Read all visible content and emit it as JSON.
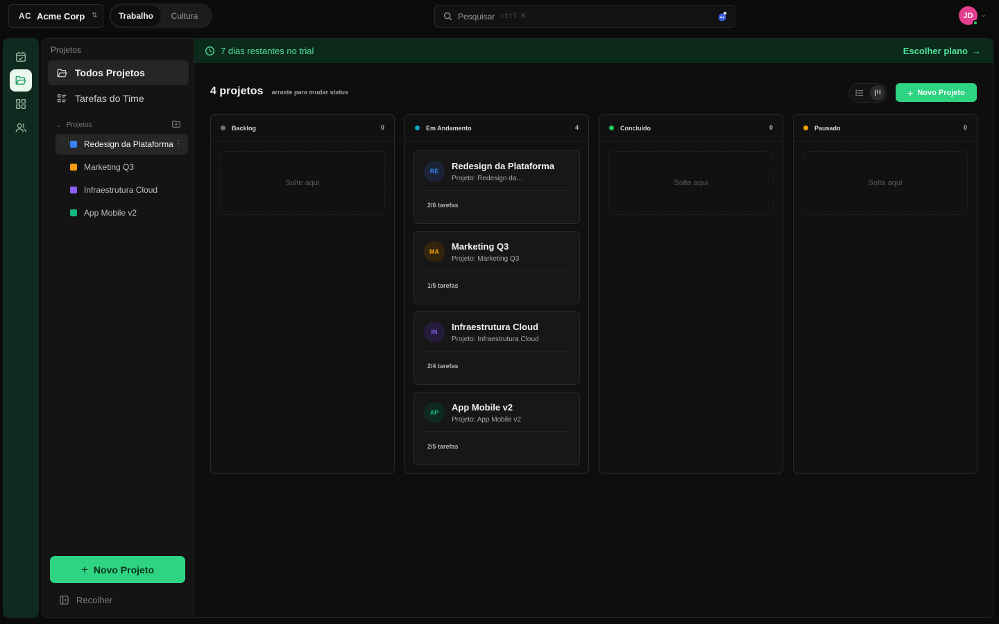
{
  "org": {
    "abbr": "AC",
    "name": "Acme Corp"
  },
  "workspace_tabs": [
    {
      "label": "Trabalho"
    },
    {
      "label": "Cultura"
    }
  ],
  "search": {
    "placeholder": "Pesquisar",
    "shortcut": "ctrl K"
  },
  "user": {
    "initials": "JD",
    "avatar_color": "#e23f8f",
    "status": "online"
  },
  "rail": {
    "items": [
      {
        "icon": "calendar-check-icon",
        "active": false
      },
      {
        "icon": "folder-open-icon",
        "active": true
      },
      {
        "icon": "grid-icon",
        "active": false
      },
      {
        "icon": "users-icon",
        "active": false
      }
    ]
  },
  "sidebar": {
    "title": "Projetos",
    "nav": [
      {
        "label": "Todos Projetos",
        "icon": "folder-open-icon",
        "active": true
      },
      {
        "label": "Tarefas do Time",
        "icon": "task-list-icon",
        "active": false
      }
    ],
    "section_label": "Projetos",
    "projects": [
      {
        "label": "Redesign da Plataforma",
        "color": "#3b82f6",
        "active": true
      },
      {
        "label": "Marketing Q3",
        "color": "#f59e0b",
        "active": false
      },
      {
        "label": "Infraestrutura Cloud",
        "color": "#8b5cf6",
        "active": false
      },
      {
        "label": "App Mobile v2",
        "color": "#10b981",
        "active": false
      }
    ],
    "new_project_label": "Novo Projeto",
    "collapse_label": "Recolher"
  },
  "trial": {
    "text": "7 dias restantes no trial",
    "cta": "Escolher plano"
  },
  "board": {
    "count": "4 projetos",
    "hint": "arraste para mudar status",
    "view_mode": "board",
    "new_project_label": "Novo Projeto",
    "drop_label": "Solte aqui",
    "columns": [
      {
        "title": "Backlog",
        "count": "0",
        "color": "#6b7280"
      },
      {
        "title": "Em Andamento",
        "count": "4",
        "color": "#0ea5c6"
      },
      {
        "title": "Concluído",
        "count": "0",
        "color": "#22c55e"
      },
      {
        "title": "Pausado",
        "count": "0",
        "color": "#f59e0b"
      }
    ],
    "cards": [
      {
        "initials": "RE",
        "title": "Redesign da Plataforma",
        "subtitle": "Projeto: Redesign da...",
        "tasks": "2/6 tarefas",
        "badge_bg": "#1b2336",
        "badge_fg": "#3b82f6"
      },
      {
        "initials": "MA",
        "title": "Marketing Q3",
        "subtitle": "Projeto: Marketing Q3",
        "tasks": "1/5 tarefas",
        "badge_bg": "#33250d",
        "badge_fg": "#f59e0b"
      },
      {
        "initials": "IN",
        "title": "Infraestrutura Cloud",
        "subtitle": "Projeto: Infraestrutura Cloud",
        "tasks": "2/4 tarefas",
        "badge_bg": "#251c3a",
        "badge_fg": "#8b5cf6"
      },
      {
        "initials": "AP",
        "title": "App Mobile v2",
        "subtitle": "Projeto: App Mobile v2",
        "tasks": "2/5 tarefas",
        "badge_bg": "#10291f",
        "badge_fg": "#10b981"
      }
    ]
  },
  "colors": {
    "accent": "#2fd483",
    "trial_bg": "#0c2a1c",
    "rail_bg": "#0f2a1e"
  }
}
